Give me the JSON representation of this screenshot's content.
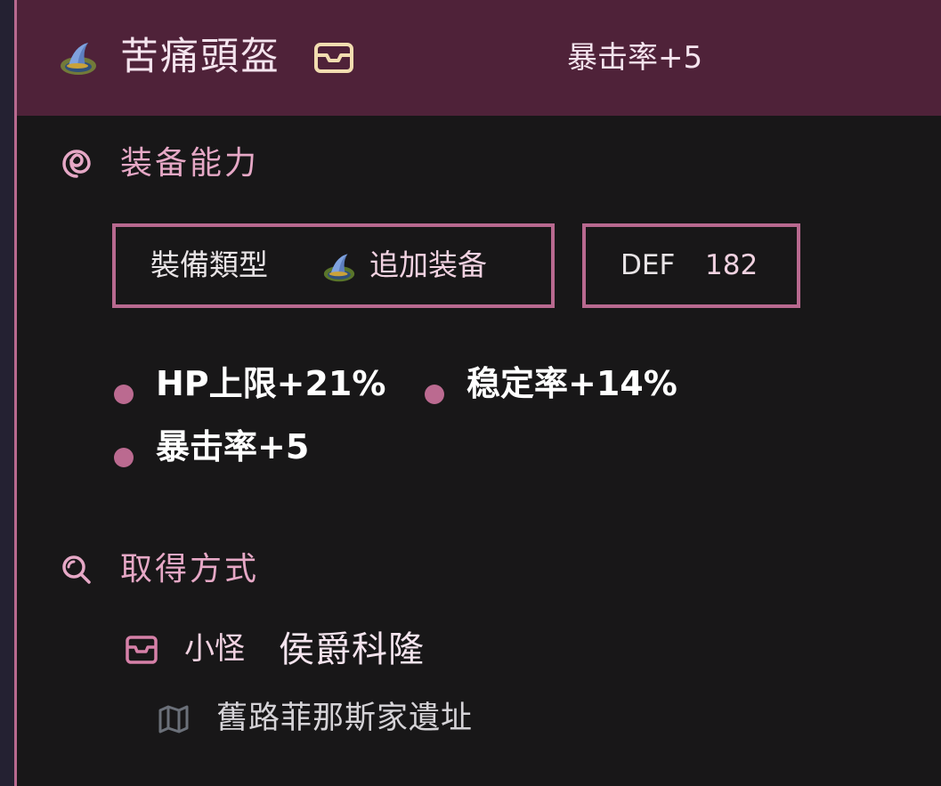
{
  "header": {
    "item_name": "苦痛頭盔",
    "stat": "暴击率+5",
    "item_icon": "wizard-hat-icon",
    "box_icon": "inbox-icon"
  },
  "equip_section": {
    "title": "装备能力",
    "icon": "spiral-icon",
    "type_label": "裝備類型",
    "type_value": "追加装备",
    "def_label": "DEF",
    "def_value": "182",
    "stats": [
      "HP上限+21%",
      "稳定率+14%",
      "暴击率+5"
    ]
  },
  "source_section": {
    "title": "取得方式",
    "icon": "search-icon",
    "source_kind": "小怪",
    "source_name": "侯爵科隆",
    "location": "舊路菲那斯家遺址",
    "kind_icon": "inbox-icon",
    "location_icon": "map-icon"
  },
  "colors": {
    "header_bg": "#4f2239",
    "accent": "#b8698f",
    "background": "#181718"
  }
}
